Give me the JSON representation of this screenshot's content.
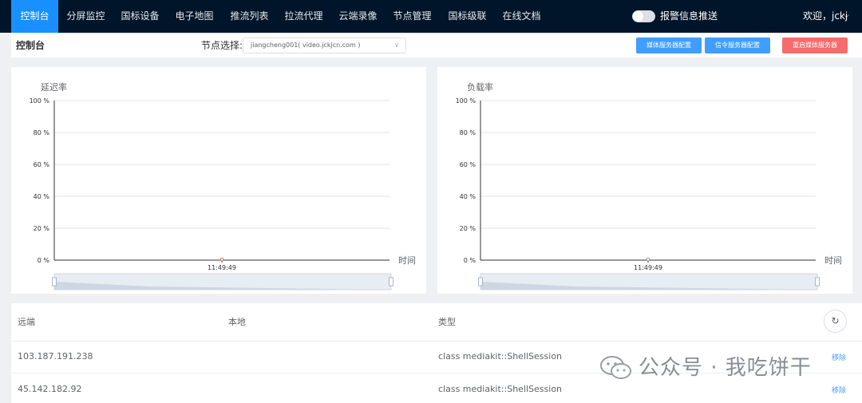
{
  "nav": {
    "items": [
      {
        "label": "控制台",
        "active": true
      },
      {
        "label": "分屏监控"
      },
      {
        "label": "国标设备"
      },
      {
        "label": "电子地图"
      },
      {
        "label": "推流列表"
      },
      {
        "label": "拉流代理"
      },
      {
        "label": "云端录像"
      },
      {
        "label": "节点管理"
      },
      {
        "label": "国标级联"
      },
      {
        "label": "在线文档"
      }
    ],
    "alarm_push_label": "报警信息推送",
    "alarm_push_enabled": false,
    "user_greeting": "欢迎，jckj"
  },
  "header": {
    "title": "控制台",
    "node_label": "节点选择:",
    "node_value": "jiangcheng001( video.jckjcn.com )",
    "buttons": {
      "media_config": "媒体服务器配置",
      "signal_config": "信令服务器配置",
      "restart_media": "重启媒体服务器"
    }
  },
  "chart_data": [
    {
      "type": "line",
      "title": "延迟率",
      "xlabel": "时间",
      "ylabel": "",
      "categories": [
        "11:49:49"
      ],
      "series": [
        {
          "values": [
            0
          ]
        }
      ],
      "ylim": [
        0,
        100
      ],
      "yticks": [
        "100 %",
        "80 %",
        "60 %",
        "40 %",
        "20 %",
        "0 %"
      ],
      "grid": true,
      "point_color": "#e06c6c"
    },
    {
      "type": "line",
      "title": "负载率",
      "xlabel": "时间",
      "ylabel": "",
      "categories": [
        "11:49:49"
      ],
      "series": [
        {
          "values": [
            0
          ]
        }
      ],
      "ylim": [
        0,
        100
      ],
      "yticks": [
        "100 %",
        "80 %",
        "60 %",
        "40 %",
        "20 %",
        "0 %"
      ],
      "grid": true,
      "point_color": "#909399"
    }
  ],
  "table": {
    "columns": [
      "远端",
      "本地",
      "类型"
    ],
    "rows": [
      {
        "remote": "103.187.191.238",
        "local": "",
        "type": "class mediakit::ShellSession",
        "action": "移除"
      },
      {
        "remote": "45.142.182.92",
        "local": "",
        "type": "class mediakit::ShellSession",
        "action": "移除"
      }
    ]
  },
  "watermark": {
    "text": "公众号 · 我吃饼干"
  }
}
